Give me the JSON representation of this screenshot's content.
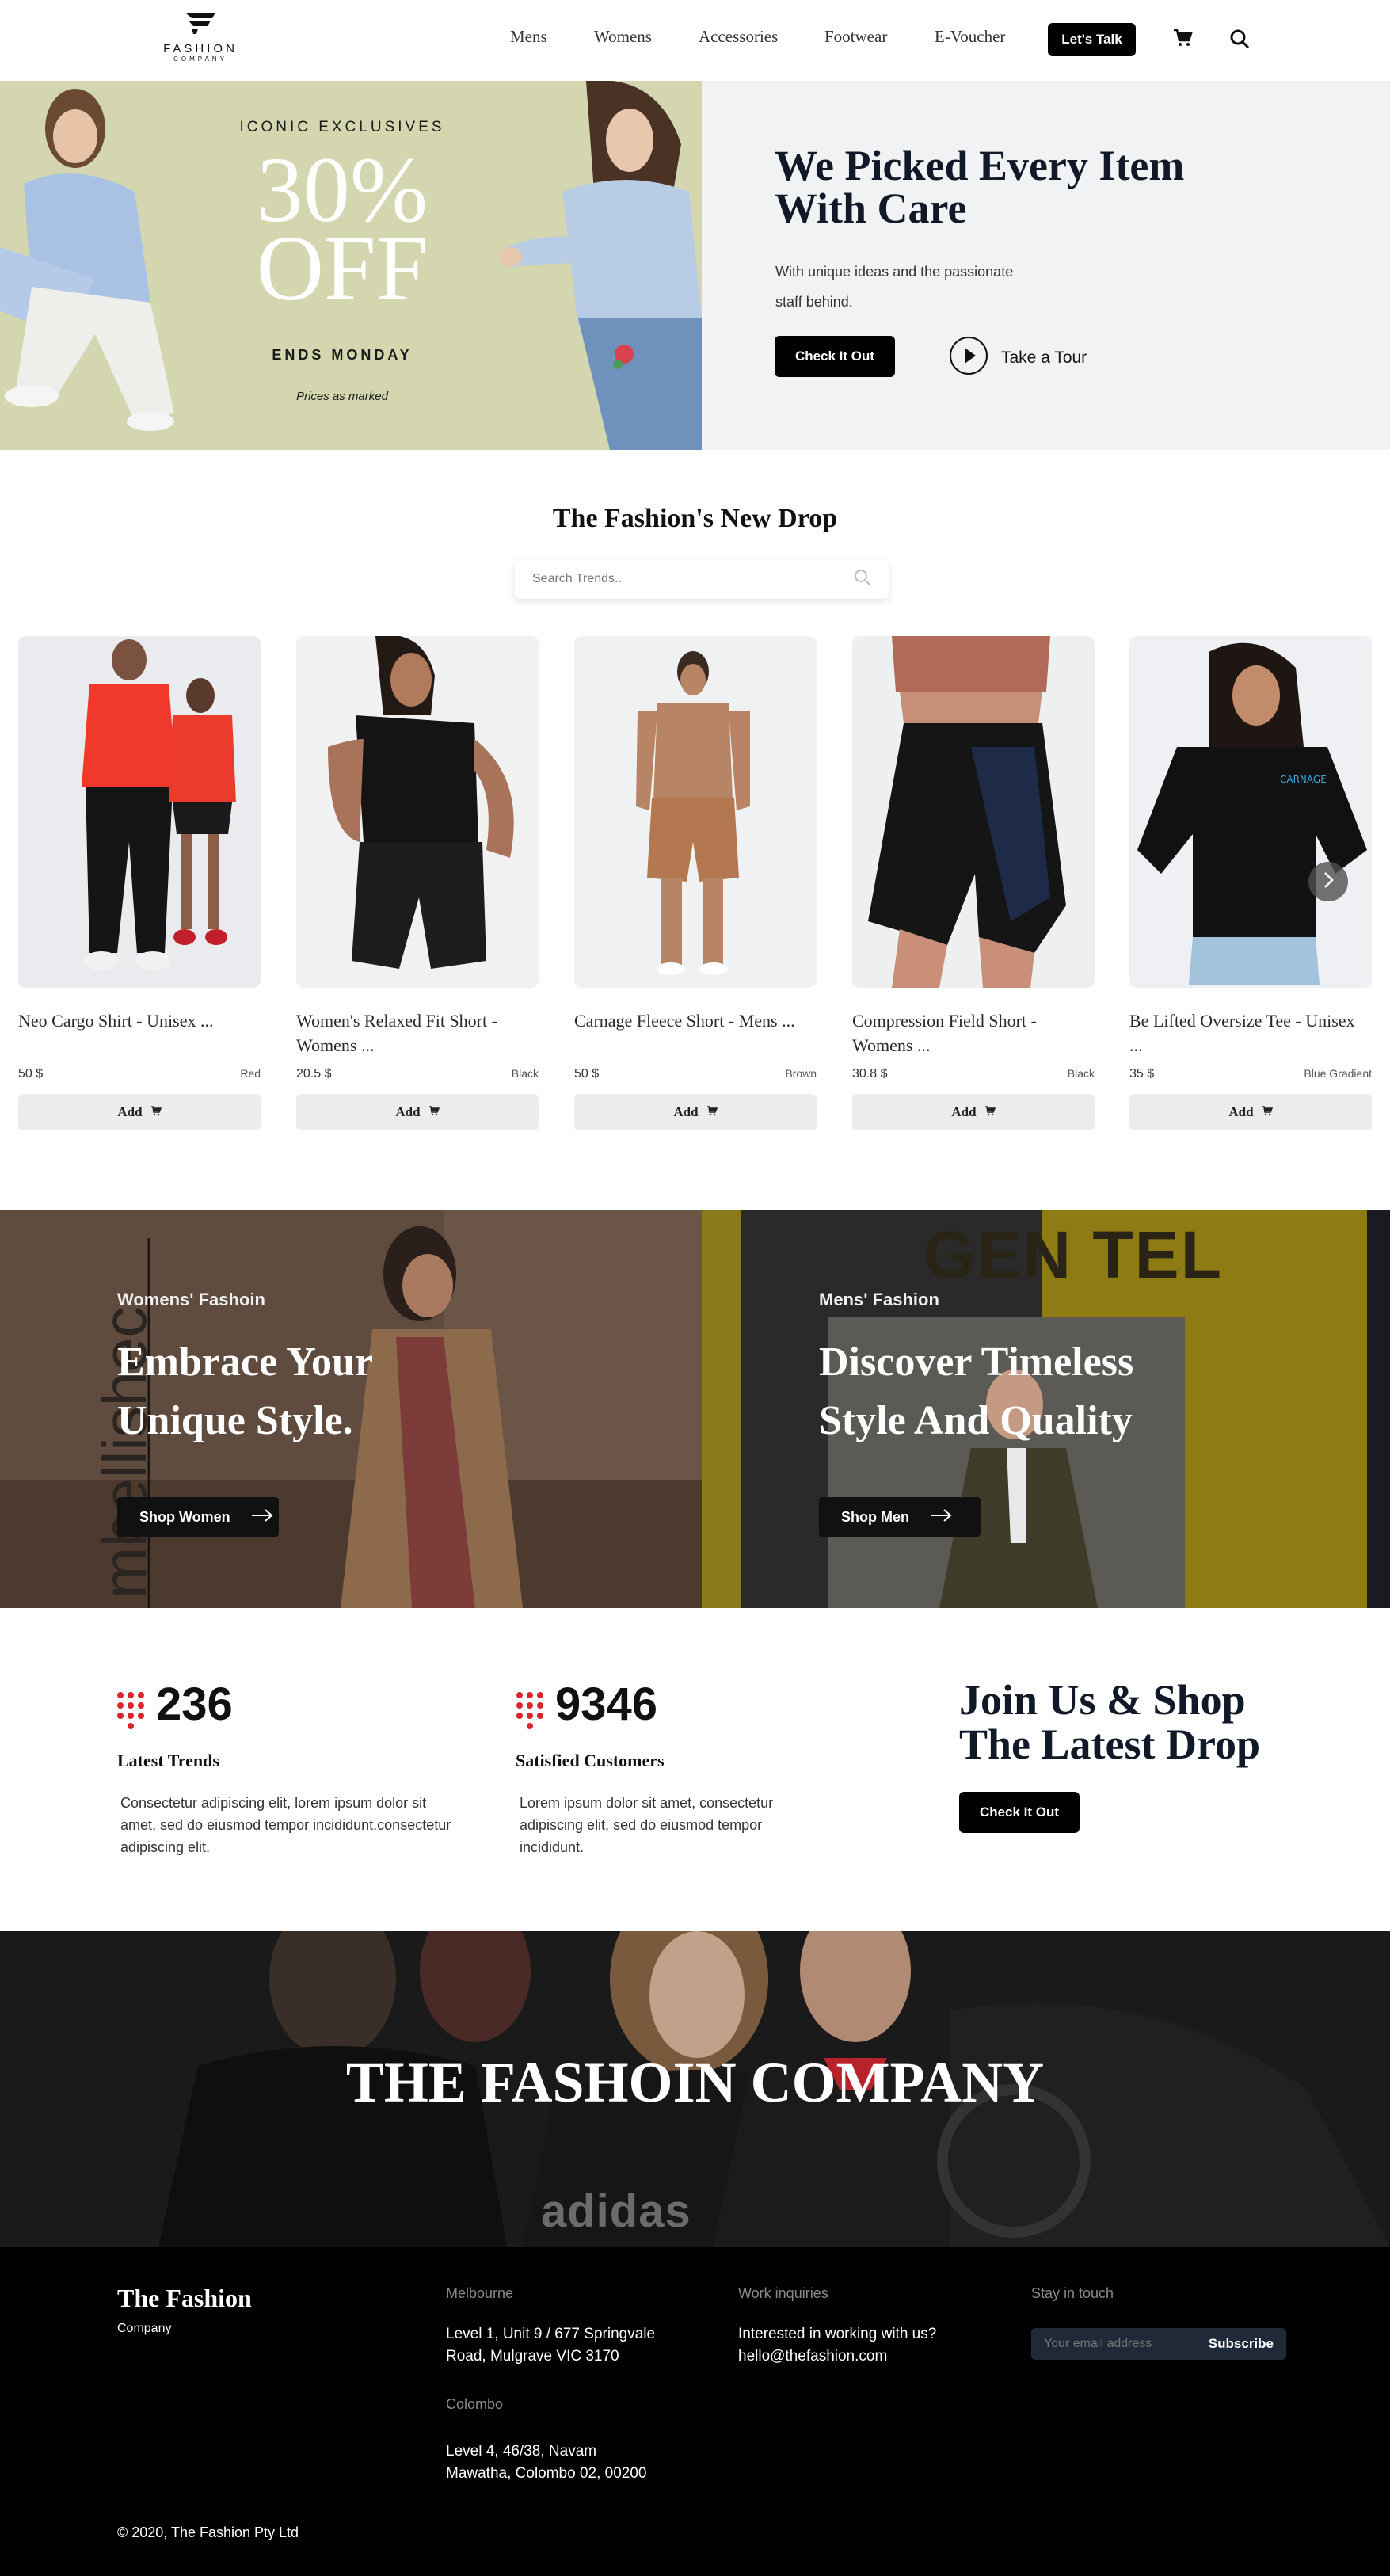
{
  "nav": {
    "logo_text": "FASHION",
    "logo_sub": "COMPANY",
    "items": [
      "Mens",
      "Womens",
      "Accessories",
      "Footwear",
      "E-Voucher"
    ],
    "cta": "Let's Talk"
  },
  "hero": {
    "promo_kicker": "ICONIC EXCLUSIVES",
    "promo_big_1": "30%",
    "promo_big_2": "OFF",
    "promo_ends": "ENDS MONDAY",
    "promo_note": "Prices as marked",
    "title_line1": "We Picked Every Item",
    "title_line2": "With Care",
    "sub_line1": "With unique ideas and the passionate",
    "sub_line2": "staff behind.",
    "primary_btn": "Check It Out",
    "tour_label": "Take a Tour"
  },
  "drop": {
    "title": "The Fashion's New Drop",
    "search_placeholder": "Search Trends.."
  },
  "products": [
    {
      "name": "Neo Cargo Shirt - Unisex ...",
      "price": "50 $",
      "color": "Red",
      "add": "Add"
    },
    {
      "name": "Women's Relaxed Fit Short - Womens ...",
      "price": "20.5 $",
      "color": "Black",
      "add": "Add"
    },
    {
      "name": "Carnage Fleece Short - Mens ...",
      "price": "50 $",
      "color": "Brown",
      "add": "Add"
    },
    {
      "name": "Compression Field Short - Womens ...",
      "price": "30.8 $",
      "color": "Black",
      "add": "Add"
    },
    {
      "name": "Be Lifted Oversize Tee - Unisex ...",
      "price": "35 $",
      "color": "Blue Gradient",
      "add": "Add"
    }
  ],
  "banners": {
    "women": {
      "kicker": "Womens' Fashoin",
      "line1": "Embrace Your",
      "line2": "Unique Style.",
      "btn": "Shop Women",
      "bg_text": "mbellishec"
    },
    "men": {
      "kicker": "Mens' Fashion",
      "line1": "Discover Timeless",
      "line2": "Style And Quality",
      "btn": "Shop Men",
      "bg_text": "GEN TEL"
    }
  },
  "stats": [
    {
      "number": "236",
      "label": "Latest Trends",
      "desc": "Consectetur adipiscing elit, lorem ipsum dolor sit amet, sed do eiusmod tempor incididunt.consectetur adipiscing elit."
    },
    {
      "number": "9346",
      "label": "Satisfied Customers",
      "desc": "Lorem ipsum dolor sit amet, consectetur adipiscing elit, sed do eiusmod tempor incididunt."
    }
  ],
  "join": {
    "line1": "Join Us & Shop",
    "line2": "The Latest Drop",
    "btn": "Check It Out"
  },
  "brand_banner": {
    "title": "THE FASHOIN COMPANY",
    "shirt_text": "adidas"
  },
  "footer": {
    "brand": "The Fashion",
    "brand_sub": "Company",
    "melbourne_head": "Melbourne",
    "melbourne_line1": "Level 1, Unit 9 / 677 Springvale",
    "melbourne_line2": "Road, Mulgrave VIC 3170",
    "colombo_head": "Colombo",
    "colombo_line1": "Level 4, 46/38, Navam",
    "colombo_line2": "Mawatha, Colombo 02, 00200",
    "work_head": "Work inquiries",
    "work_line1": "Interested in working with us?",
    "work_line2": "hello@thefashion.com",
    "stay_head": "Stay in touch",
    "email_placeholder": "Your email address",
    "subscribe": "Subscribe",
    "copyright": "© 2020, The Fashion Pty Ltd"
  },
  "colors": {
    "accent_red": "#d9262b",
    "black": "#000000",
    "hero_green": "#d3d6af",
    "hero_gray": "#f1f2f4"
  }
}
